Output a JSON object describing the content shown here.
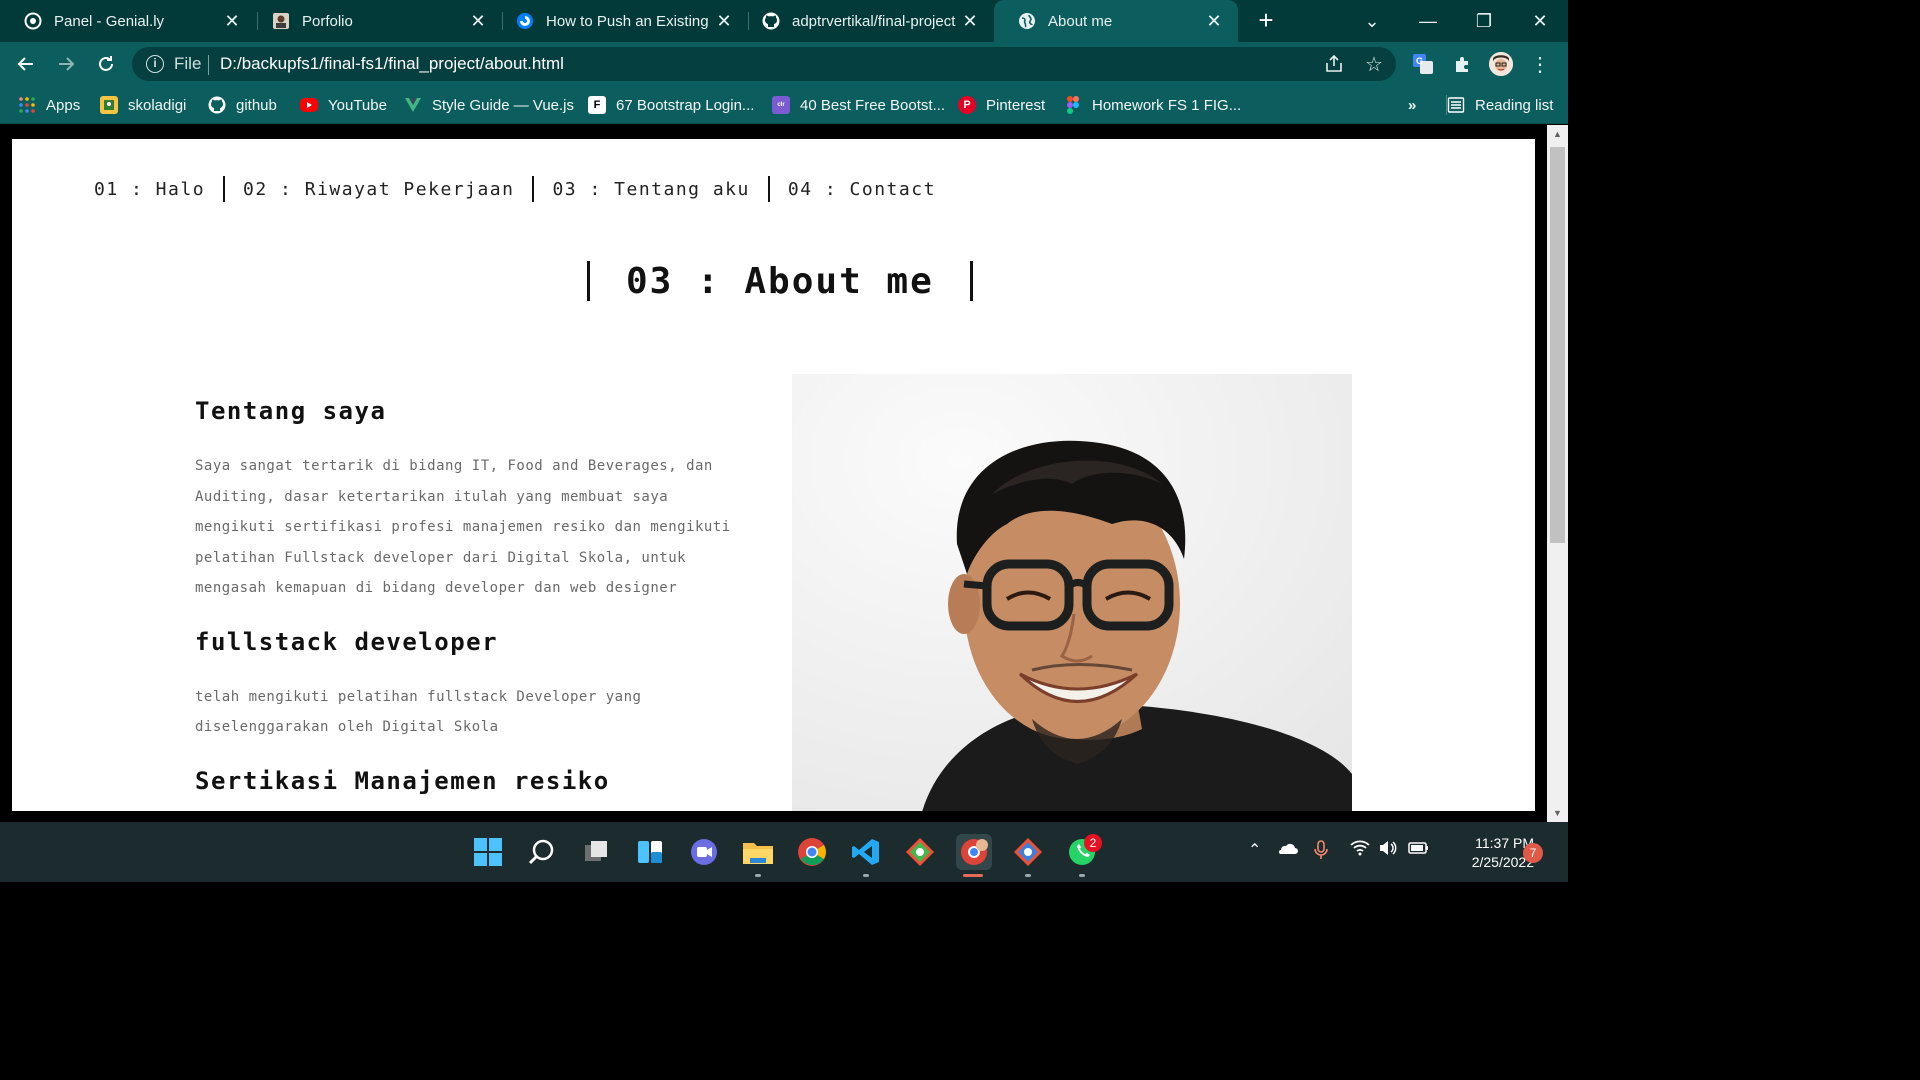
{
  "browser": {
    "tabs": [
      {
        "title": "Panel - Genial.ly",
        "icon": "genially-icon"
      },
      {
        "title": "Porfolio",
        "icon": "portfolio-favicon"
      },
      {
        "title": "How to Push an Existing F",
        "icon": "digitalocean-icon"
      },
      {
        "title": "adptrvertikal/final-project",
        "icon": "github-icon"
      },
      {
        "title": "About me",
        "icon": "globe-icon",
        "active": true
      }
    ],
    "address": {
      "scheme_label": "File",
      "url": "D:/backupfs1/final-fs1/final_project/about.html"
    },
    "bookmarks": [
      {
        "label": "Apps",
        "icon": "apps-grid-icon"
      },
      {
        "label": "skoladigi",
        "icon": "skoladigi-icon"
      },
      {
        "label": "github",
        "icon": "github-icon"
      },
      {
        "label": "YouTube",
        "icon": "youtube-icon"
      },
      {
        "label": "Style Guide — Vue.js",
        "icon": "vue-icon"
      },
      {
        "label": "67 Bootstrap Login...",
        "icon": "bootstrap-f-icon"
      },
      {
        "label": "40 Best Free Bootst...",
        "icon": "colorlib-icon"
      },
      {
        "label": "Pinterest",
        "icon": "pinterest-icon"
      },
      {
        "label": "Homework FS 1 FIG...",
        "icon": "figma-icon"
      }
    ],
    "bookmarks_overflow": "»",
    "reading_list": "Reading list"
  },
  "site": {
    "nav": [
      {
        "label": "01 : Halo"
      },
      {
        "label": "02 : Riwayat Pekerjaan"
      },
      {
        "label": "03 : Tentang aku"
      },
      {
        "label": "04 : Contact"
      }
    ],
    "heading": "03 : About me",
    "sections": [
      {
        "title": "Tentang saya",
        "body": "Saya sangat tertarik di bidang IT, Food and Beverages, dan Auditing, dasar ketertarikan itulah yang membuat saya mengikuti sertifikasi profesi manajemen resiko dan mengikuti pelatihan Fullstack developer dari Digital Skola, untuk mengasah kemapuan di bidang developer dan web designer"
      },
      {
        "title": "fullstack developer",
        "body": "telah mengikuti pelatihan fullstack Developer yang diselenggarakan oleh Digital Skola"
      },
      {
        "title": "Sertikasi Manajemen resiko",
        "body": ""
      }
    ]
  },
  "taskbar": {
    "whatsapp_badge": "2",
    "time": "11:37 PM",
    "date": "2/25/2022",
    "notifications": "7"
  },
  "colors": {
    "tab_bar": "#023a3a",
    "toolbar": "#0c5e5e",
    "page_bg": "#ffffff",
    "heading_text": "#111111",
    "body_text": "#6a6a6a",
    "taskbar": "#1c2b2e"
  }
}
